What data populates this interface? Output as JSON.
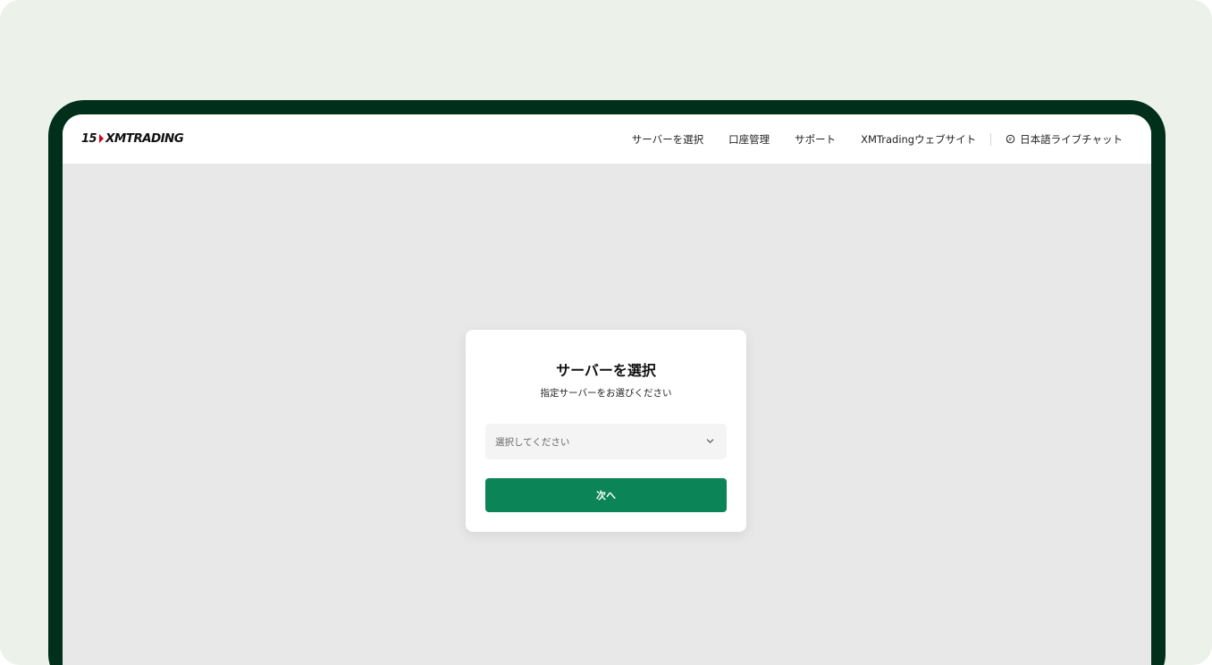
{
  "header": {
    "logo_number": "15",
    "logo_text": "XMTRADING"
  },
  "nav": {
    "items": [
      {
        "label": "サーバーを選択"
      },
      {
        "label": "口座管理"
      },
      {
        "label": "サポート"
      },
      {
        "label": "XMTradingウェブサイト"
      }
    ],
    "chat_label": "日本語ライブチャット",
    "chat_icon": "chat-bubble-icon"
  },
  "card": {
    "title": "サーバーを選択",
    "subtitle": "指定サーバーをお選びください",
    "select_placeholder": "選択してください",
    "select_icon": "chevron-down-icon",
    "next_label": "次へ"
  },
  "colors": {
    "page_bg": "#ecf2ea",
    "device_frame": "#00301c",
    "screen_bg": "#e8e8e8",
    "primary_button": "#0b8457",
    "logo_accent": "#d0021b"
  }
}
